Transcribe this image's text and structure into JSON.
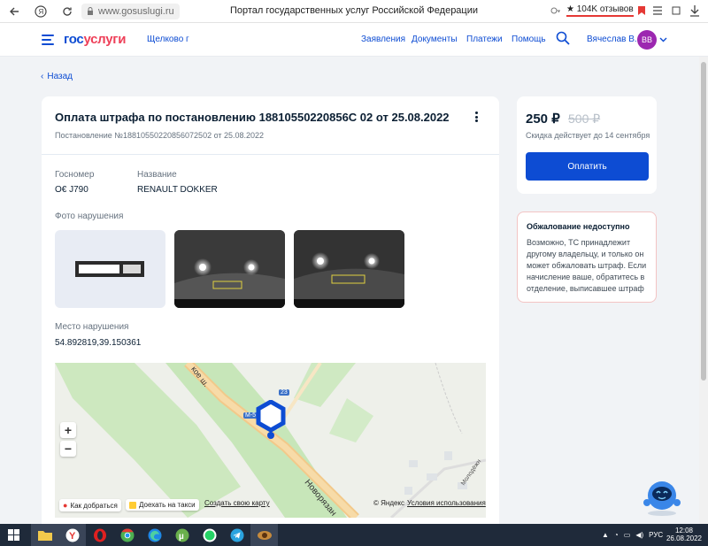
{
  "browser": {
    "url": "www.gosuslugi.ru",
    "title": "Портал государственных услуг Российской Федерации",
    "rating": "★ 104K отзывов"
  },
  "header": {
    "logo_a": "гос",
    "logo_b": "услуги",
    "region": "Щелково г",
    "nav": [
      "Заявления",
      "Документы",
      "Платежи",
      "Помощь"
    ],
    "user": "Вячеслав В.",
    "avatar": "ВВ"
  },
  "back_label": "Назад",
  "fine": {
    "title": "Оплата штрафа по постановлению 18810550220856С      02 от 25.08.2022",
    "subtitle": "Постановление №18810550220856072502 от 25.08.2022",
    "plate_label": "Госномер",
    "plate_value": "О€      Ј790",
    "name_label": "Название",
    "name_value": "RENAULT DOKKER",
    "photo_label": "Фото нарушения",
    "place_label": "Место нарушения",
    "place_value": "54.892819,39.150361"
  },
  "map": {
    "zoom_in": "+",
    "zoom_out": "−",
    "route_label": "Как добраться",
    "taxi_label": "Доехать на такси",
    "create_label": "Создать свою карту",
    "copyright": "© Яндекс",
    "terms": "Условия использования",
    "road_label": "Новорязан",
    "road_label2": "кое ш.",
    "road_badge": "М-5",
    "road_num": "23",
    "street_label": "Молодёжн"
  },
  "payment": {
    "price": "250 ₽",
    "old_price": "500 ₽",
    "discount_note": "Скидка действует до 14 сентября",
    "pay_button": "Оплатить"
  },
  "appeal": {
    "title": "Обжалование недоступно",
    "text": "Возможно, ТС принадлежит другому владельцу, и только он может обжаловать штраф. Если начисление ваше, обратитесь в отделение, выписавшее штраф"
  },
  "taskbar": {
    "lang": "РУС",
    "time": "12:08",
    "date": "26.08.2022"
  },
  "colors": {
    "accent": "#0d4cd3",
    "brand_red": "#ee3f58",
    "appeal_border": "#f3c4c4"
  }
}
